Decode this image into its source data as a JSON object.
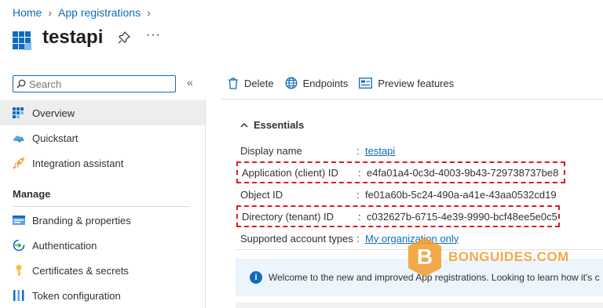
{
  "breadcrumb": {
    "home": "Home",
    "app_registrations": "App registrations"
  },
  "header": {
    "title": "testapi",
    "more": "···"
  },
  "search": {
    "placeholder": "Search",
    "value": ""
  },
  "sidebar": {
    "items": [
      {
        "label": "Overview"
      },
      {
        "label": "Quickstart"
      },
      {
        "label": "Integration assistant"
      }
    ],
    "manage_heading": "Manage",
    "manage_items": [
      {
        "label": "Branding & properties"
      },
      {
        "label": "Authentication"
      },
      {
        "label": "Certificates & secrets"
      },
      {
        "label": "Token configuration"
      }
    ]
  },
  "toolbar": {
    "delete": "Delete",
    "endpoints": "Endpoints",
    "preview": "Preview features"
  },
  "essentials": {
    "heading": "Essentials",
    "rows": [
      {
        "key": "Display name",
        "value": "testapi"
      },
      {
        "key": "Application (client) ID",
        "value": "e4fa01a4-0c3d-4003-9b43-729738737be8"
      },
      {
        "key": "Object ID",
        "value": "fe01a60b-5c24-490a-a41e-43aa0532cd19"
      },
      {
        "key": "Directory (tenant) ID",
        "value": "c032627b-6715-4e39-9990-bcf48ee5e0c5"
      },
      {
        "key": "Supported account types",
        "value": "My organization only"
      }
    ]
  },
  "banner": {
    "text": "Welcome to the new and improved App registrations. Looking to learn how it's c"
  },
  "watermark": {
    "text": "BONGUIDES.COM",
    "letter": "B"
  },
  "colors": {
    "accent": "#0f6cbd",
    "highlight": "#e01a1a",
    "watermark": "#f39c2a"
  }
}
